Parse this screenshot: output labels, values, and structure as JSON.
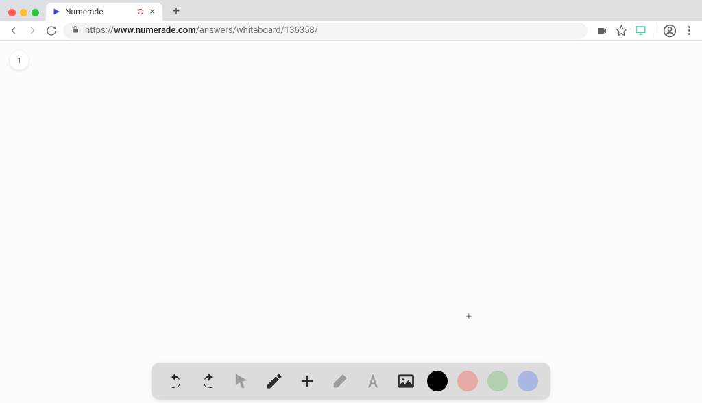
{
  "browser": {
    "tab_title": "Numerade",
    "url_scheme": "https://",
    "url_host": "www.numerade.com",
    "url_path": "/answers/whiteboard/136358/"
  },
  "whiteboard": {
    "page_number": "1"
  },
  "toolbar": {
    "colors": {
      "black": "#000000",
      "red": "#e7a9a4",
      "green": "#b0d0ae",
      "blue": "#acb8e4"
    }
  }
}
